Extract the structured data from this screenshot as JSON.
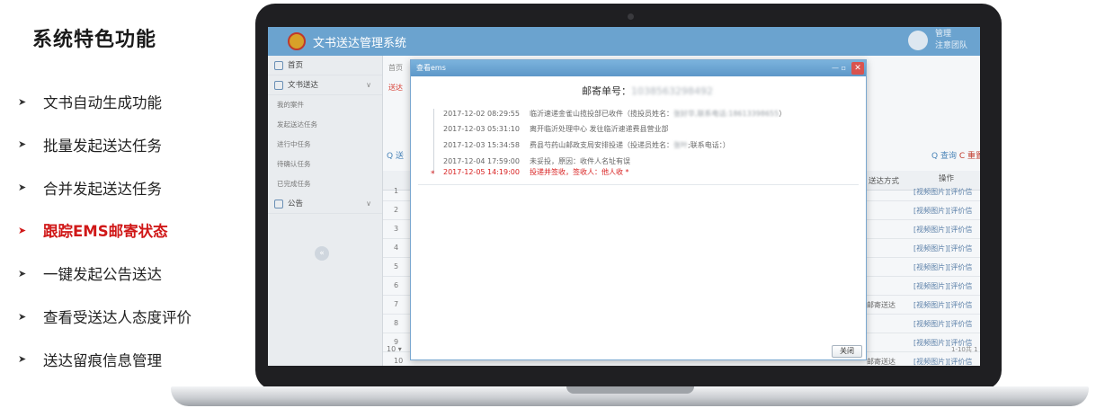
{
  "heading": "系统特色功能",
  "features": [
    {
      "text": "文书自动生成功能",
      "active": false
    },
    {
      "text": "批量发起送达任务",
      "active": false
    },
    {
      "text": "合并发起送达任务",
      "active": false
    },
    {
      "text": "跟踪EMS邮寄状态",
      "active": true
    },
    {
      "text": "一键发起公告送达",
      "active": false
    },
    {
      "text": "查看受送达人态度评价",
      "active": false
    },
    {
      "text": "送达留痕信息管理",
      "active": false
    }
  ],
  "app": {
    "title": "文书送达管理系统",
    "user_lines": [
      "管理",
      "注意团队"
    ],
    "sidebar": [
      {
        "label": "首页",
        "type": "top"
      },
      {
        "label": "文书送达",
        "type": "top",
        "expand": "∨"
      },
      {
        "label": "我的案件",
        "type": "sub"
      },
      {
        "label": "发起送达任务",
        "type": "sub"
      },
      {
        "label": "进行中任务",
        "type": "sub"
      },
      {
        "label": "待确认任务",
        "type": "sub"
      },
      {
        "label": "已完成任务",
        "type": "sub"
      },
      {
        "label": "公告",
        "type": "top",
        "expand": "∨"
      }
    ],
    "sidebar_toggle": "«",
    "breadcrumb": "首页",
    "subtab": "送达",
    "search_prefix": "Q 送",
    "query_label": "Q 查询",
    "reset_label": "C 重置",
    "columns": {
      "method": "送达方式",
      "op": "操作"
    },
    "rows": [
      {
        "num": "1",
        "method": "",
        "op": "[视频图片][评价信"
      },
      {
        "num": "2",
        "method": "",
        "op": "[视频图片][评价信"
      },
      {
        "num": "3",
        "method": "",
        "op": "[视频图片][评价信"
      },
      {
        "num": "4",
        "method": "",
        "op": "[视频图片][评价信"
      },
      {
        "num": "5",
        "method": "",
        "op": "[视频图片][评价信"
      },
      {
        "num": "6",
        "method": "",
        "op": "[视频图片][评价信"
      },
      {
        "num": "7",
        "method": "邮寄送达",
        "op": "[视频图片][评价信"
      },
      {
        "num": "8",
        "method": "",
        "op": "[视频图片][评价信"
      },
      {
        "num": "9",
        "method": "",
        "op": "[视频图片][评价信"
      },
      {
        "num": "10",
        "method": "邮寄送达",
        "op": "[视频图片][评价信"
      }
    ],
    "pager_size": "10 ▾",
    "pager_info": "1-10共 1"
  },
  "modal": {
    "title": "查看ems",
    "controls": "— ▫",
    "close_x": "✕",
    "track_label": "邮寄单号：",
    "track_number": "1038563298492",
    "events": [
      {
        "time": "2017-12-02 08:29:55",
        "text": "临沂速递金雀山揽投部已收件（揽投员姓名：",
        "blur": "张好华,联系电话:18613398655",
        "tail": "）",
        "latest": false
      },
      {
        "time": "2017-12-03 05:31:10",
        "text": "离开临沂处理中心 发往临沂速递费县营业部",
        "blur": "",
        "tail": "",
        "latest": false
      },
      {
        "time": "2017-12-03 15:34:58",
        "text": "费县芍药山邮政支局安排投递（投递员姓名：",
        "blur": "张叶",
        "tail": ";联系电话：）",
        "latest": false
      },
      {
        "time": "2017-12-04 17:59:00",
        "text": "未妥投，原因：收件人名址有误",
        "blur": "",
        "tail": "",
        "latest": false
      },
      {
        "time": "2017-12-05 14:19:00",
        "text": "投递并签收，签收人：他人收 *",
        "blur": "",
        "tail": "",
        "latest": true
      }
    ],
    "latest_marker": "*",
    "close_button": "关闭"
  }
}
